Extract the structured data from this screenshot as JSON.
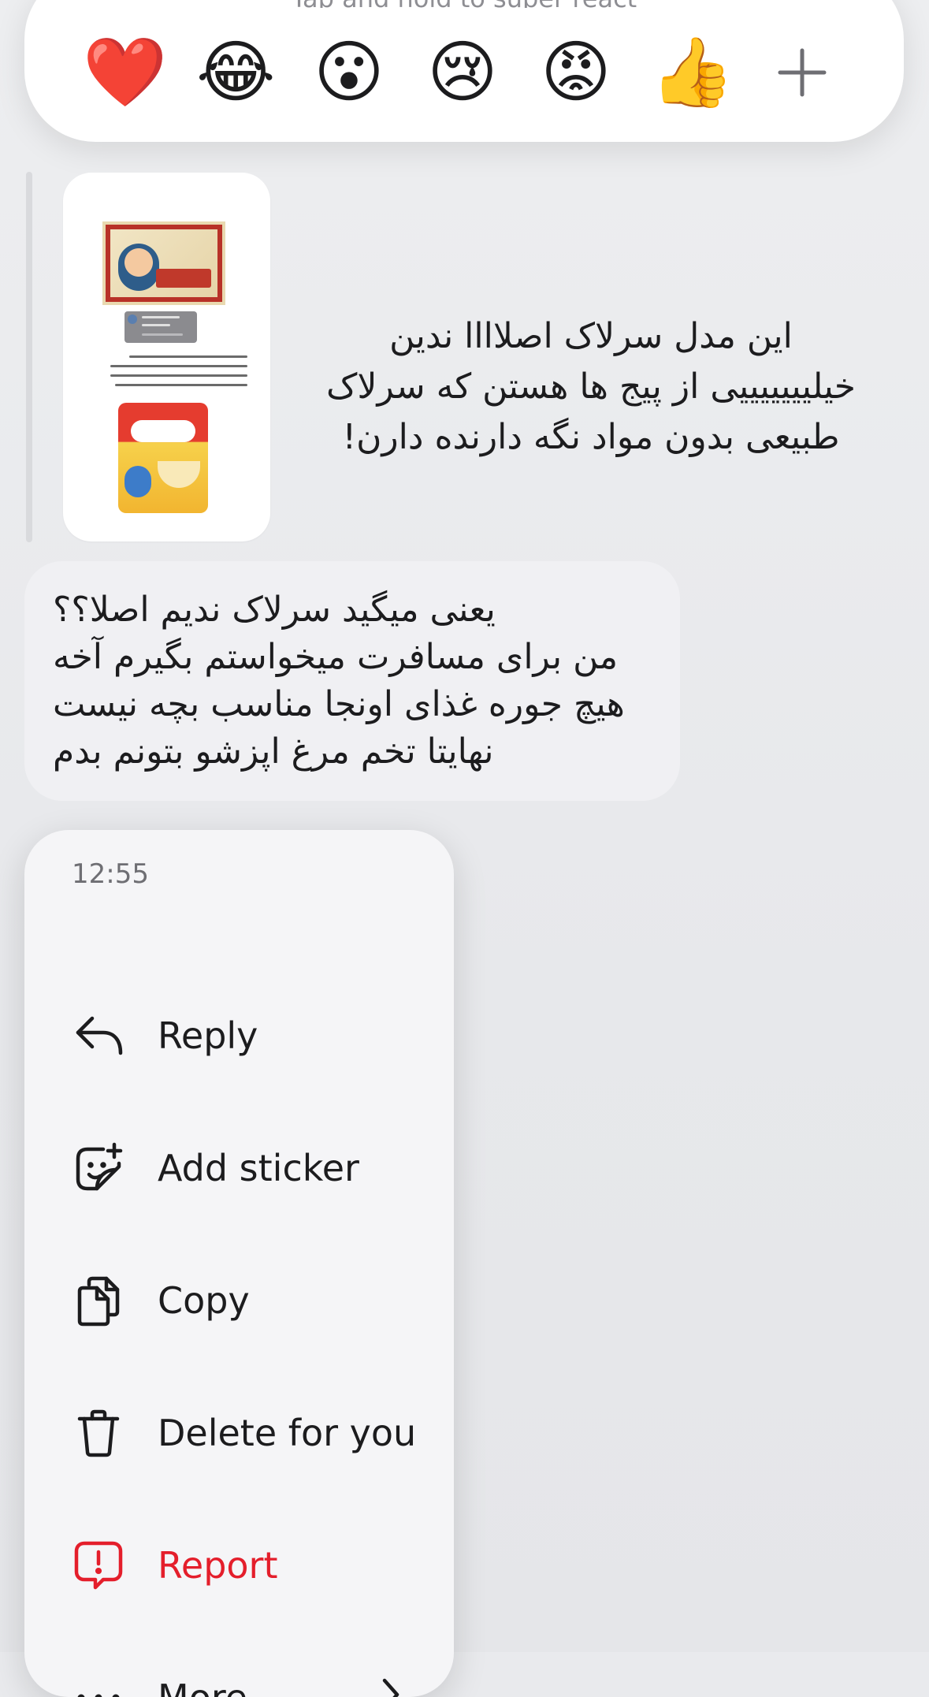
{
  "reactions": {
    "hint": "Tap and hold to super react",
    "emojis": [
      {
        "name": "red-heart",
        "glyph": "❤️"
      },
      {
        "name": "face-with-tears-of-joy",
        "glyph": "😂"
      },
      {
        "name": "face-with-open-mouth",
        "glyph": "😮"
      },
      {
        "name": "crying-face",
        "glyph": "😢"
      },
      {
        "name": "angry-face",
        "glyph": "😡"
      },
      {
        "name": "thumbs-up",
        "glyph": "👍"
      }
    ],
    "add_icon": "plus-icon"
  },
  "shared_post": {
    "caption": "این مدل سرلاک اصلاااا ندین خیلیییییییی از پیج ها هستن که سرلاک طبیعی بدون مواد نگه دارنده دارن!"
  },
  "message": {
    "text": "یعنی میگید سرلاک ندیم اصلا؟؟\nمن برای مسافرت میخواستم بگیرم آخه\nهیچ جوره غذای اونجا مناسب بچه نیست\nنهایتا تخم مرغ اپزشو بتونم بدم"
  },
  "context_menu": {
    "time": "12:55",
    "items": [
      {
        "label": "Reply",
        "icon": "reply-icon"
      },
      {
        "label": "Add sticker",
        "icon": "add-sticker-icon"
      },
      {
        "label": "Copy",
        "icon": "copy-icon"
      },
      {
        "label": "Delete for you",
        "icon": "trash-icon"
      },
      {
        "label": "Report",
        "icon": "report-icon"
      },
      {
        "label": "More",
        "icon": "more-icon"
      }
    ],
    "danger_color": "#e41e2b"
  }
}
